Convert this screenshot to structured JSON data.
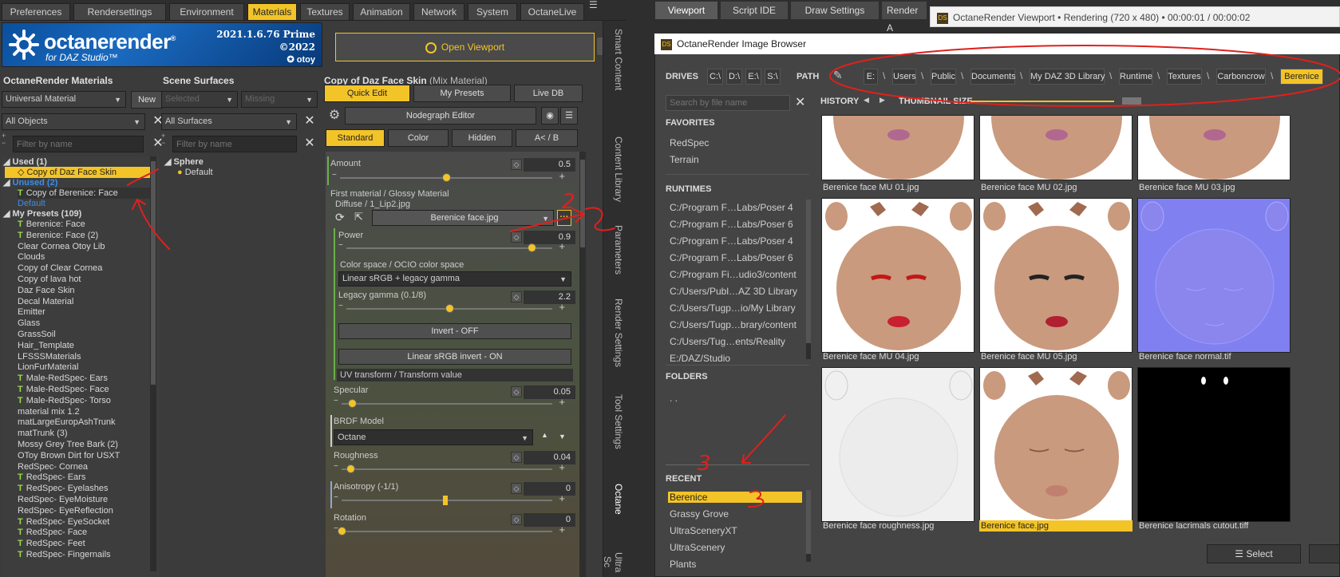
{
  "left_tabs": [
    "Preferences",
    "Rendersettings",
    "Environment",
    "Materials",
    "Textures",
    "Animation",
    "Network",
    "System",
    "OctaneLive"
  ],
  "banner": {
    "product": "octanerender",
    "registered": "®",
    "subtitle": "for DAZ Studio™",
    "version": "2021.1.6.76 Prime",
    "copyright": "©2022",
    "maker": "otoy"
  },
  "open_viewport": "Open Viewport",
  "help": "?",
  "materials": {
    "header": "OctaneRender Materials",
    "type_value": "Universal Material",
    "new_label": "New",
    "filter_value": "All Objects",
    "filter_placeholder": "Filter by name",
    "used_group": "Used (1)",
    "used_item": "Copy of Daz Face Skin",
    "unused_group": "Unused (2)",
    "unused_items": [
      {
        "t": true,
        "label": "Copy of Berenice: Face"
      },
      {
        "t": false,
        "label": "Default"
      }
    ],
    "presets_group": "My Presets (109)",
    "presets": [
      {
        "t": true,
        "label": "Berenice: Face"
      },
      {
        "t": true,
        "label": "Berenice: Face (2)"
      },
      {
        "t": false,
        "label": "Clear Cornea Otoy Lib"
      },
      {
        "t": false,
        "label": "Clouds"
      },
      {
        "t": false,
        "label": "Copy of Clear Cornea"
      },
      {
        "t": false,
        "label": "Copy of lava hot"
      },
      {
        "t": false,
        "label": "Daz Face Skin"
      },
      {
        "t": false,
        "label": "Decal Material"
      },
      {
        "t": false,
        "label": "Emitter"
      },
      {
        "t": false,
        "label": "Glass"
      },
      {
        "t": false,
        "label": "GrassSoil"
      },
      {
        "t": false,
        "label": "Hair_Template"
      },
      {
        "t": false,
        "label": "LFSSSMaterials"
      },
      {
        "t": false,
        "label": "LionFurMaterial"
      },
      {
        "t": true,
        "label": "Male-RedSpec- Ears"
      },
      {
        "t": true,
        "label": "Male-RedSpec- Face"
      },
      {
        "t": true,
        "label": "Male-RedSpec- Torso"
      },
      {
        "t": false,
        "label": "material mix 1.2"
      },
      {
        "t": false,
        "label": "matLargeEuropAshTrunk"
      },
      {
        "t": false,
        "label": "matTrunk (3)"
      },
      {
        "t": false,
        "label": "Mossy Grey Tree Bark (2)"
      },
      {
        "t": false,
        "label": "OToy Brown Dirt for USXT"
      },
      {
        "t": false,
        "label": "RedSpec- Cornea"
      },
      {
        "t": true,
        "label": "RedSpec- Ears"
      },
      {
        "t": true,
        "label": "RedSpec- Eyelashes"
      },
      {
        "t": false,
        "label": "RedSpec- EyeMoisture"
      },
      {
        "t": false,
        "label": "RedSpec- EyeReflection"
      },
      {
        "t": true,
        "label": "RedSpec- EyeSocket"
      },
      {
        "t": true,
        "label": "RedSpec- Face"
      },
      {
        "t": true,
        "label": "RedSpec- Feet"
      },
      {
        "t": true,
        "label": "RedSpec- Fingernails"
      }
    ]
  },
  "scene": {
    "header": "Scene Surfaces",
    "selected_label": "Selected",
    "missing_label": "Missing",
    "filter_value": "All Surfaces",
    "filter_placeholder": "Filter by name",
    "group": "Sphere",
    "item": "Default"
  },
  "material_panel": {
    "title": "Copy of Daz Face Skin",
    "subtitle": "(Mix Material)",
    "tabs": [
      "Quick Edit",
      "My Presets",
      "Live DB"
    ],
    "nodegraph": "Nodegraph Editor",
    "subtabs": [
      "Standard",
      "Color",
      "Hidden",
      "A< / B"
    ],
    "amount_label": "Amount",
    "amount_value": "0.5",
    "first_material": "First material / Glossy Material",
    "diffuse_path": "Diffuse / 1_Lip2.jpg",
    "texture_file": "Berenice face.jpg",
    "power_label": "Power",
    "power_value": "0.9",
    "colorspace_label": "Color space / OCIO color space",
    "colorspace_value": "Linear sRGB + legacy gamma",
    "legacy_label": "Legacy gamma (0.1/8)",
    "legacy_value": "2.2",
    "invert_label": "Invert - OFF",
    "linear_invert": "Linear sRGB invert - ON",
    "uv_transform": "UV transform / Transform value",
    "specular_label": "Specular",
    "specular_value": "0.05",
    "brdf_label": "BRDF Model",
    "brdf_value": "Octane",
    "roughness_label": "Roughness",
    "roughness_value": "0.04",
    "aniso_label": "Anisotropy (-1/1)",
    "aniso_value": "0",
    "rotation_label": "Rotation",
    "rotation_value": "0",
    "slider_levels": {
      "amount": 0.5,
      "power": 0.9,
      "legacy": 0.5,
      "specular": 0.05,
      "roughness": 0.04,
      "anisotropy": 0.5,
      "rotation": 0
    }
  },
  "side_tabs": [
    "Smart Content",
    "Content Library",
    "Parameters",
    "Render Settings",
    "Tool Settings",
    "Octane",
    "Ultra Sc"
  ],
  "right_tabs": [
    "Viewport",
    "Script IDE",
    "Draw Settings",
    "Render A"
  ],
  "viewport_window_title": "OctaneRender Viewport • Rendering (720 x 480) • 00:00:01 / 00:00:02",
  "ds_icon": "DS",
  "browser": {
    "title": "OctaneRender Image Browser",
    "drives_label": "DRIVES",
    "drives": [
      "C:\\",
      "D:\\",
      "E:\\",
      "S:\\"
    ],
    "path_label": "PATH",
    "path": [
      "E:",
      "Users",
      "Public",
      "Documents",
      "My DAZ 3D Library",
      "Runtime",
      "Textures",
      "Carboncrow",
      "Berenice"
    ],
    "path_sep": "\\",
    "search_placeholder": "Search by file name",
    "history_label": "HISTORY",
    "thumb_size_label": "THUMBNAIL SIZE",
    "favorites_label": "FAVORITES",
    "favorites": [
      "RedSpec",
      "Terrain"
    ],
    "runtimes_label": "RUNTIMES",
    "runtimes": [
      "C:/Program F…Labs/Poser 4",
      "C:/Program F…Labs/Poser 6",
      "C:/Program F…Labs/Poser 4",
      "C:/Program F…Labs/Poser 6",
      "C:/Program Fi…udio3/content",
      "C:/Users/Publ…AZ 3D Library",
      "C:/Users/Tugp…io/My Library",
      "C:/Users/Tugp…brary/content",
      "C:/Users/Tug…ents/Reality",
      "E:/DAZ/Studio"
    ],
    "folders_label": "FOLDERS",
    "folders": [
      ". ."
    ],
    "recent_label": "RECENT",
    "recent": [
      "Berenice",
      "Grassy Grove",
      "UltraSceneryXT",
      "UltraScenery",
      "Plants"
    ],
    "thumbs": [
      {
        "label": "Berenice face MU 01.jpg",
        "kind": "face-crop",
        "selected": false
      },
      {
        "label": "Berenice face MU 02.jpg",
        "kind": "face-crop",
        "selected": false
      },
      {
        "label": "Berenice face MU 03.jpg",
        "kind": "face-crop",
        "selected": false
      },
      {
        "label": "Berenice face MU 04.jpg",
        "kind": "face-red",
        "selected": false
      },
      {
        "label": "Berenice face MU 05.jpg",
        "kind": "face-dark",
        "selected": false
      },
      {
        "label": "Berenice face normal.tif",
        "kind": "normal",
        "selected": false
      },
      {
        "label": "Berenice face roughness.jpg",
        "kind": "rough",
        "selected": false
      },
      {
        "label": "Berenice face.jpg",
        "kind": "face-plain",
        "selected": true
      },
      {
        "label": "Berenice lacrimals cutout.tiff",
        "kind": "black",
        "selected": false
      }
    ],
    "select_label": "Select"
  },
  "annotations": [
    "2",
    "3"
  ],
  "colors": {
    "accent": "#f3c428",
    "skin": "#c99a7e",
    "normal_map": "#8080f0",
    "annotation": "#e0201c"
  }
}
